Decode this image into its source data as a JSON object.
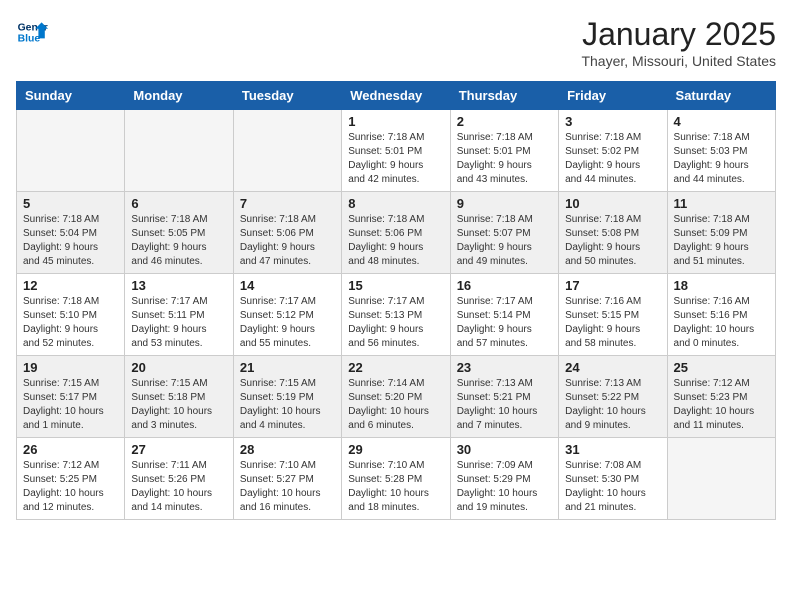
{
  "header": {
    "logo_line1": "General",
    "logo_line2": "Blue",
    "month_year": "January 2025",
    "location": "Thayer, Missouri, United States"
  },
  "weekdays": [
    "Sunday",
    "Monday",
    "Tuesday",
    "Wednesday",
    "Thursday",
    "Friday",
    "Saturday"
  ],
  "weeks": [
    [
      {
        "day": "",
        "info": ""
      },
      {
        "day": "",
        "info": ""
      },
      {
        "day": "",
        "info": ""
      },
      {
        "day": "1",
        "info": "Sunrise: 7:18 AM\nSunset: 5:01 PM\nDaylight: 9 hours\nand 42 minutes."
      },
      {
        "day": "2",
        "info": "Sunrise: 7:18 AM\nSunset: 5:01 PM\nDaylight: 9 hours\nand 43 minutes."
      },
      {
        "day": "3",
        "info": "Sunrise: 7:18 AM\nSunset: 5:02 PM\nDaylight: 9 hours\nand 44 minutes."
      },
      {
        "day": "4",
        "info": "Sunrise: 7:18 AM\nSunset: 5:03 PM\nDaylight: 9 hours\nand 44 minutes."
      }
    ],
    [
      {
        "day": "5",
        "info": "Sunrise: 7:18 AM\nSunset: 5:04 PM\nDaylight: 9 hours\nand 45 minutes."
      },
      {
        "day": "6",
        "info": "Sunrise: 7:18 AM\nSunset: 5:05 PM\nDaylight: 9 hours\nand 46 minutes."
      },
      {
        "day": "7",
        "info": "Sunrise: 7:18 AM\nSunset: 5:06 PM\nDaylight: 9 hours\nand 47 minutes."
      },
      {
        "day": "8",
        "info": "Sunrise: 7:18 AM\nSunset: 5:06 PM\nDaylight: 9 hours\nand 48 minutes."
      },
      {
        "day": "9",
        "info": "Sunrise: 7:18 AM\nSunset: 5:07 PM\nDaylight: 9 hours\nand 49 minutes."
      },
      {
        "day": "10",
        "info": "Sunrise: 7:18 AM\nSunset: 5:08 PM\nDaylight: 9 hours\nand 50 minutes."
      },
      {
        "day": "11",
        "info": "Sunrise: 7:18 AM\nSunset: 5:09 PM\nDaylight: 9 hours\nand 51 minutes."
      }
    ],
    [
      {
        "day": "12",
        "info": "Sunrise: 7:18 AM\nSunset: 5:10 PM\nDaylight: 9 hours\nand 52 minutes."
      },
      {
        "day": "13",
        "info": "Sunrise: 7:17 AM\nSunset: 5:11 PM\nDaylight: 9 hours\nand 53 minutes."
      },
      {
        "day": "14",
        "info": "Sunrise: 7:17 AM\nSunset: 5:12 PM\nDaylight: 9 hours\nand 55 minutes."
      },
      {
        "day": "15",
        "info": "Sunrise: 7:17 AM\nSunset: 5:13 PM\nDaylight: 9 hours\nand 56 minutes."
      },
      {
        "day": "16",
        "info": "Sunrise: 7:17 AM\nSunset: 5:14 PM\nDaylight: 9 hours\nand 57 minutes."
      },
      {
        "day": "17",
        "info": "Sunrise: 7:16 AM\nSunset: 5:15 PM\nDaylight: 9 hours\nand 58 minutes."
      },
      {
        "day": "18",
        "info": "Sunrise: 7:16 AM\nSunset: 5:16 PM\nDaylight: 10 hours\nand 0 minutes."
      }
    ],
    [
      {
        "day": "19",
        "info": "Sunrise: 7:15 AM\nSunset: 5:17 PM\nDaylight: 10 hours\nand 1 minute."
      },
      {
        "day": "20",
        "info": "Sunrise: 7:15 AM\nSunset: 5:18 PM\nDaylight: 10 hours\nand 3 minutes."
      },
      {
        "day": "21",
        "info": "Sunrise: 7:15 AM\nSunset: 5:19 PM\nDaylight: 10 hours\nand 4 minutes."
      },
      {
        "day": "22",
        "info": "Sunrise: 7:14 AM\nSunset: 5:20 PM\nDaylight: 10 hours\nand 6 minutes."
      },
      {
        "day": "23",
        "info": "Sunrise: 7:13 AM\nSunset: 5:21 PM\nDaylight: 10 hours\nand 7 minutes."
      },
      {
        "day": "24",
        "info": "Sunrise: 7:13 AM\nSunset: 5:22 PM\nDaylight: 10 hours\nand 9 minutes."
      },
      {
        "day": "25",
        "info": "Sunrise: 7:12 AM\nSunset: 5:23 PM\nDaylight: 10 hours\nand 11 minutes."
      }
    ],
    [
      {
        "day": "26",
        "info": "Sunrise: 7:12 AM\nSunset: 5:25 PM\nDaylight: 10 hours\nand 12 minutes."
      },
      {
        "day": "27",
        "info": "Sunrise: 7:11 AM\nSunset: 5:26 PM\nDaylight: 10 hours\nand 14 minutes."
      },
      {
        "day": "28",
        "info": "Sunrise: 7:10 AM\nSunset: 5:27 PM\nDaylight: 10 hours\nand 16 minutes."
      },
      {
        "day": "29",
        "info": "Sunrise: 7:10 AM\nSunset: 5:28 PM\nDaylight: 10 hours\nand 18 minutes."
      },
      {
        "day": "30",
        "info": "Sunrise: 7:09 AM\nSunset: 5:29 PM\nDaylight: 10 hours\nand 19 minutes."
      },
      {
        "day": "31",
        "info": "Sunrise: 7:08 AM\nSunset: 5:30 PM\nDaylight: 10 hours\nand 21 minutes."
      },
      {
        "day": "",
        "info": ""
      }
    ]
  ]
}
